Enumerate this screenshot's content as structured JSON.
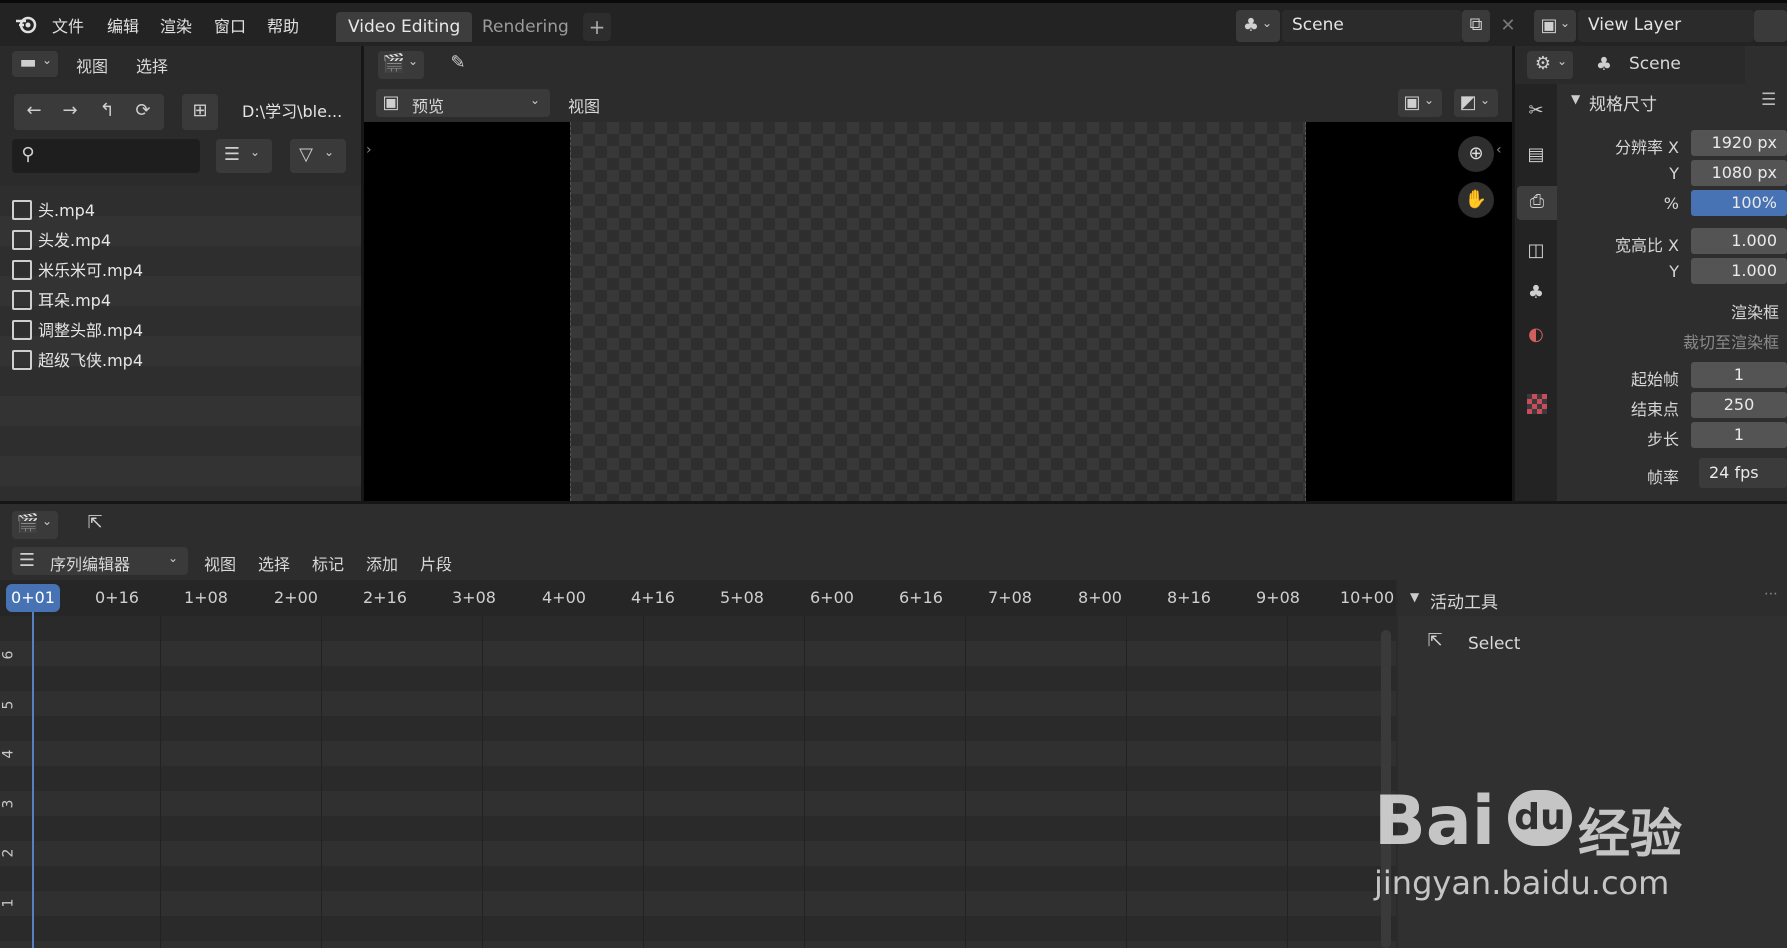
{
  "menu": {
    "file": "文件",
    "edit": "编辑",
    "render": "渲染",
    "window": "窗口",
    "help": "帮助"
  },
  "workspaces": [
    {
      "label": "Video Editing",
      "active": true
    },
    {
      "label": "Rendering",
      "active": false
    }
  ],
  "add_tab": "+",
  "scene": {
    "name": "Scene"
  },
  "view_layer": {
    "name": "View Layer"
  },
  "file_browser": {
    "menu_view": "视图",
    "menu_select": "选择",
    "path": "D:\\学习\\ble...",
    "files": [
      "头.mp4",
      "头发.mp4",
      "米乐米可.mp4",
      "耳朵.mp4",
      "调整头部.mp4",
      "超级飞侠.mp4"
    ]
  },
  "preview": {
    "mode": "预览",
    "menu_view": "视图"
  },
  "properties": {
    "scene_label": "Scene",
    "section": "规格尺寸",
    "res_x_label": "分辨率 X",
    "res_x": "1920 px",
    "res_y_label": "Y",
    "res_y": "1080 px",
    "pct_label": "%",
    "pct": "100%",
    "aspect_x_label": "宽高比 X",
    "aspect_x": "1.000",
    "aspect_y_label": "Y",
    "aspect_y": "1.000",
    "render_region": "渲染框",
    "crop_region": "裁切至渲染框",
    "frame_start_label": "起始帧",
    "frame_start": "1",
    "frame_end_label": "结束点",
    "frame_end": "250",
    "frame_step_label": "步长",
    "frame_step": "1",
    "fps_label": "帧率",
    "fps": "24 fps"
  },
  "sequencer": {
    "editor": "序列编辑器",
    "menus": [
      "视图",
      "选择",
      "标记",
      "添加",
      "片段"
    ],
    "current_frame": "0+01",
    "ticks": [
      "0+16",
      "1+08",
      "2+00",
      "2+16",
      "3+08",
      "4+00",
      "4+16",
      "5+08",
      "6+00",
      "6+16",
      "7+08",
      "8+00",
      "8+16",
      "9+08",
      "10+00"
    ],
    "channels": [
      "6",
      "5",
      "4",
      "3",
      "2",
      "1"
    ]
  },
  "active_tool": {
    "title": "活动工具",
    "tool": "Select"
  },
  "watermark": {
    "brand": "Bai",
    "brand2": "du",
    "cn": "经验",
    "url": "jingyan.baidu.com"
  },
  "colors": {
    "accent": "#4772b3",
    "playhead": "#5680c2"
  }
}
